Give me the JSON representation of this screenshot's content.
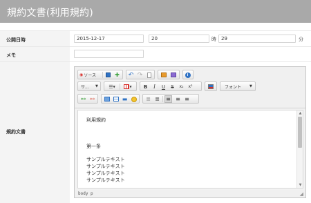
{
  "header": {
    "title": "規約文書(利用規約)"
  },
  "form": {
    "publish": {
      "label": "公開日時",
      "date": "2015-12-17",
      "hour": "20",
      "hour_suffix": "時",
      "minute": "29",
      "minute_suffix": "分"
    },
    "memo": {
      "label": "メモ",
      "value": ""
    },
    "document": {
      "label": "規約文書"
    }
  },
  "editor": {
    "toolbar": {
      "source_label": "ソース",
      "format_label": "サ...",
      "font_label": "フォント",
      "bold": "B",
      "italic": "I",
      "underline": "U",
      "strike": "S",
      "subscript": "x₂",
      "superscript": "x²"
    },
    "content_lines": [
      "利用規約",
      "第一条",
      "サンプルテキスト",
      "サンプルテキスト",
      "サンプルテキスト",
      "サンプルテキスト"
    ],
    "path": "body  p"
  },
  "colors": {
    "header_bg": "#a9a9a9",
    "label_bg": "#f4f4f4",
    "icon_red": "#d9302c",
    "icon_blue": "#2f72c4",
    "icon_green": "#3aa03a",
    "icon_orange": "#e89a2c"
  }
}
